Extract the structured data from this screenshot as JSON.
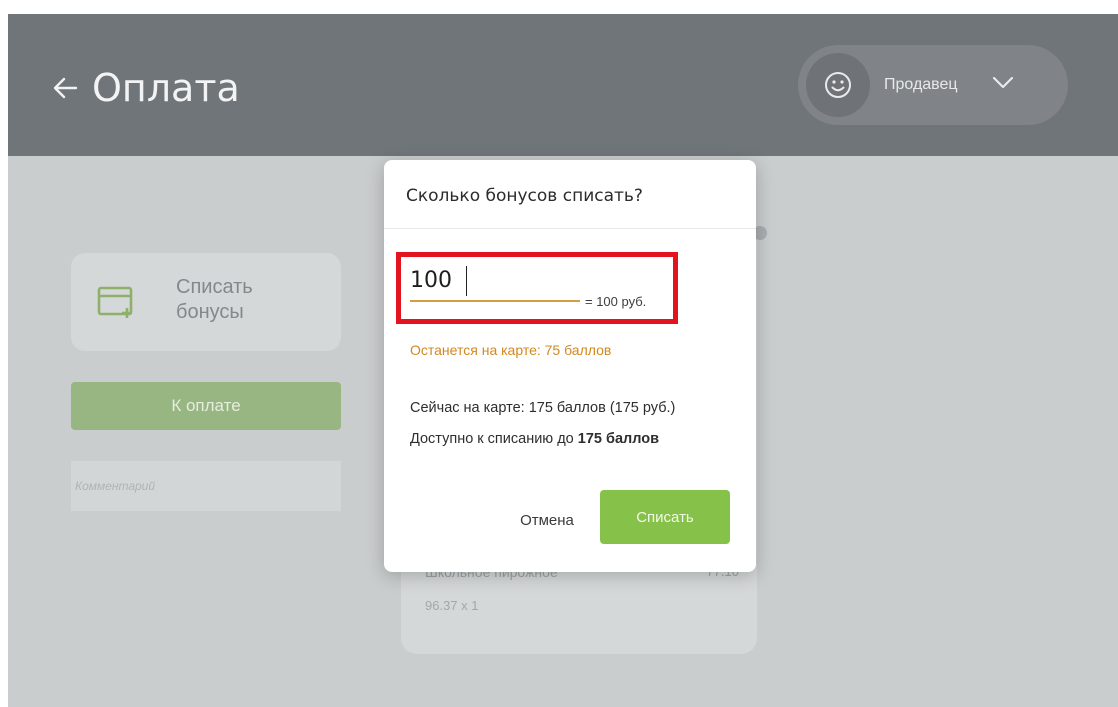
{
  "header": {
    "title": "Оплата",
    "back_icon": "arrow-left-icon",
    "user_label": "Продавец",
    "user_icon": "smiley-icon",
    "dropdown_icon": "chevron-down-icon"
  },
  "sidebar": {
    "bonus_card_label": "Списать бонусы",
    "bonus_card_icon": "card-add-icon",
    "pay_button": "К оплате",
    "comment_placeholder": "Комментарий"
  },
  "order": {
    "item_name": "Школьное пирожное",
    "item_price": "77.10",
    "item_qty": "96.37 x 1"
  },
  "dialog": {
    "title": "Сколько бонусов списать?",
    "input_value": "100",
    "equivalent": "= 100 руб.",
    "remaining": "Останется на карте: 75 баллов",
    "on_card": "Сейчас на карте: 175 баллов (175 руб.)",
    "available_prefix": "Доступно к списанию до",
    "available_amount": "175 баллов",
    "cancel_label": "Отмена",
    "confirm_label": "Списать"
  },
  "colors": {
    "header_bg": "#70757a",
    "overlay_bg": "#c9cdcd",
    "accent_green": "#86c14a",
    "warning_orange": "#d4871e",
    "highlight_red": "#e3141f"
  }
}
